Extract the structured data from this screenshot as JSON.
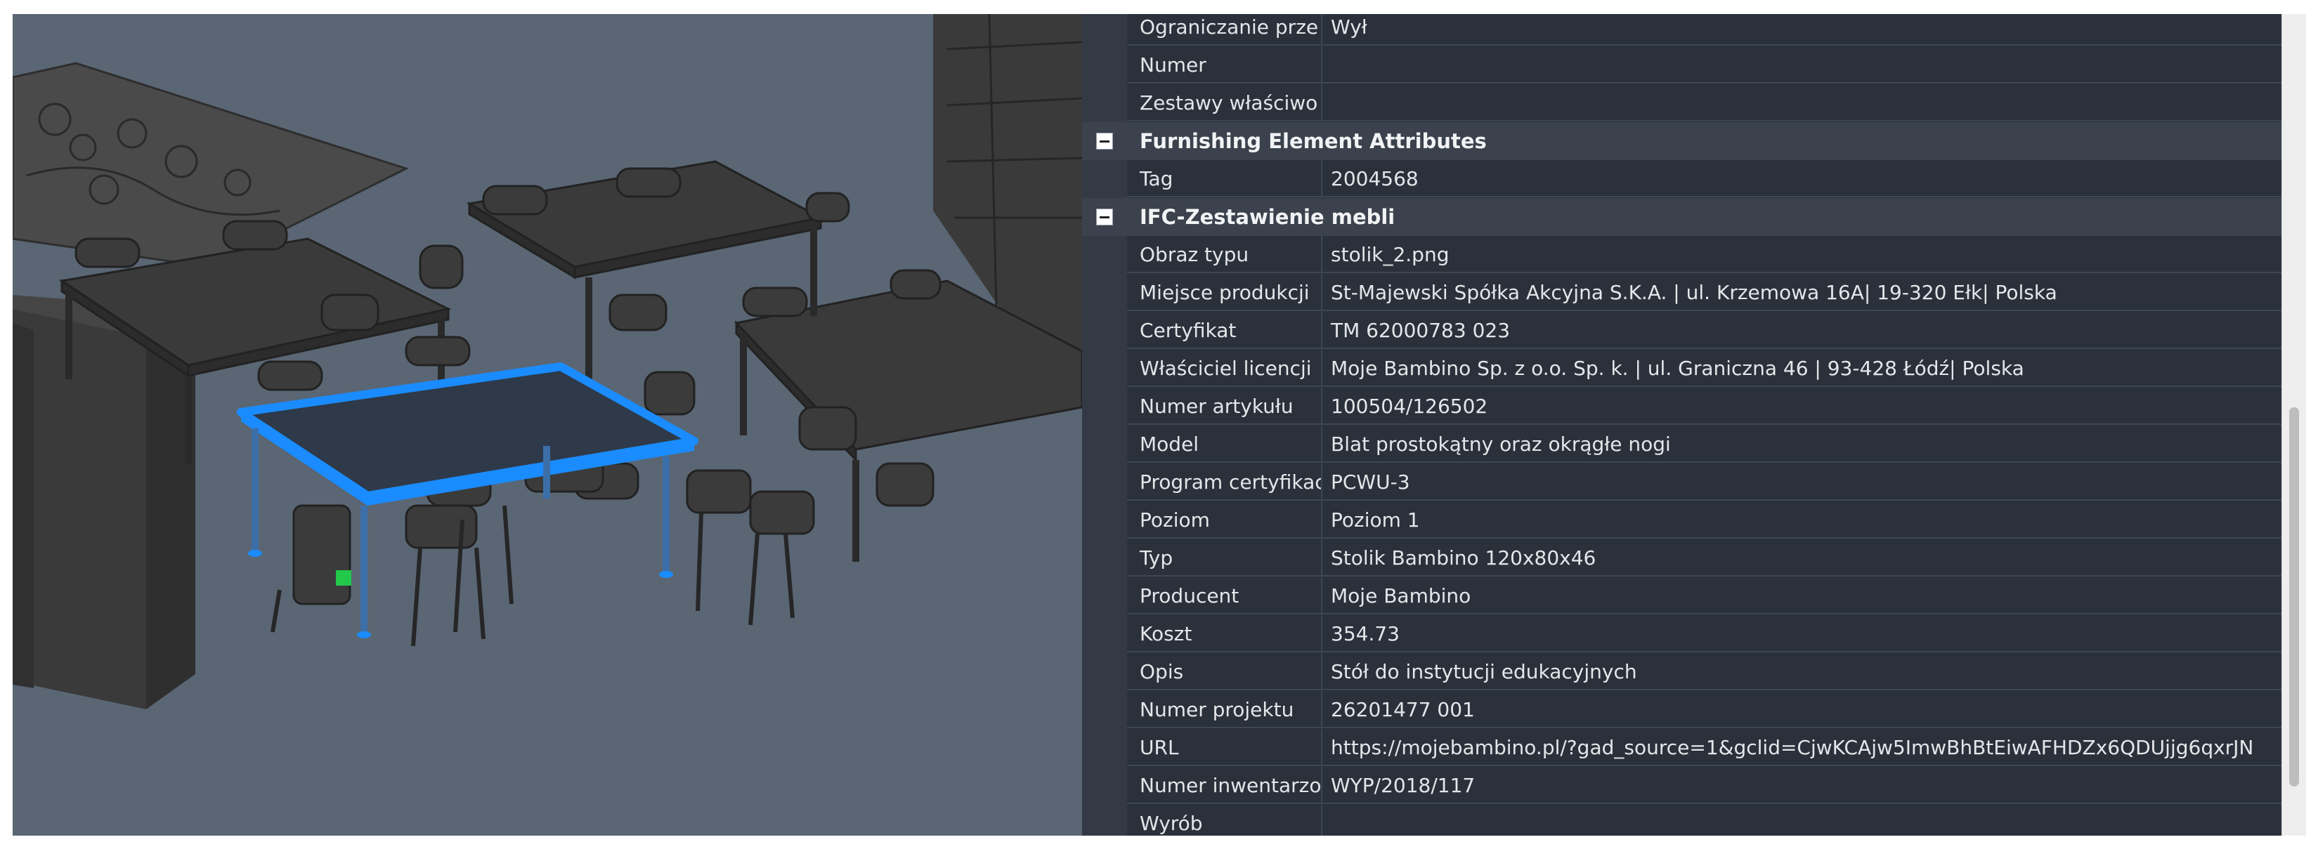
{
  "properties": {
    "top_rows": [
      {
        "name": "Ograniczanie prze",
        "value": "Wył"
      },
      {
        "name": "Numer",
        "value": ""
      },
      {
        "name": "Zestawy właściwo",
        "value": ""
      }
    ],
    "group_furnishing": {
      "title": "Furnishing Element Attributes",
      "rows": [
        {
          "name": "Tag",
          "value": "2004568"
        }
      ]
    },
    "group_ifc": {
      "title": "IFC-Zestawienie mebli",
      "rows": [
        {
          "name": "Obraz typu",
          "value": "stolik_2.png"
        },
        {
          "name": "Miejsce produkcji",
          "value": "St-Majewski Spółka Akcyjna S.K.A. | ul. Krzemowa 16A| 19-320 Ełk| Polska"
        },
        {
          "name": "Certyfikat",
          "value": "TM 62000783 023"
        },
        {
          "name": "Właściciel licencji",
          "value": "Moje Bambino Sp. z o.o. Sp. k. | ul. Graniczna 46 | 93-428 Łódź| Polska"
        },
        {
          "name": "Numer artykułu",
          "value": "100504/126502"
        },
        {
          "name": "Model",
          "value": "Blat prostokątny oraz okrągłe nogi"
        },
        {
          "name": "Program certyfikac",
          "value": "PCWU-3"
        },
        {
          "name": "Poziom",
          "value": "Poziom 1"
        },
        {
          "name": "Typ",
          "value": "Stolik Bambino 120x80x46"
        },
        {
          "name": "Producent",
          "value": "Moje Bambino"
        },
        {
          "name": "Koszt",
          "value": "354.73"
        },
        {
          "name": "Opis",
          "value": "Stół do instytucji edukacyjnych"
        },
        {
          "name": "Numer projektu",
          "value": "26201477 001"
        },
        {
          "name": "URL",
          "value": "https://mojebambino.pl/?gad_source=1&gclid=CjwKCAjw5ImwBhBtEiwAFHDZx6QDUjjg6qxrJN"
        },
        {
          "name": "Numer inwentarzo",
          "value": "WYP/2018/117"
        },
        {
          "name": "Wyrób",
          "value": ""
        }
      ]
    }
  },
  "colors": {
    "selection": "#1a8cff",
    "grip": "#22c84a",
    "furniture": "#3d3d3d",
    "floor": "#5a6674",
    "panel_bg": "#2b313b"
  }
}
